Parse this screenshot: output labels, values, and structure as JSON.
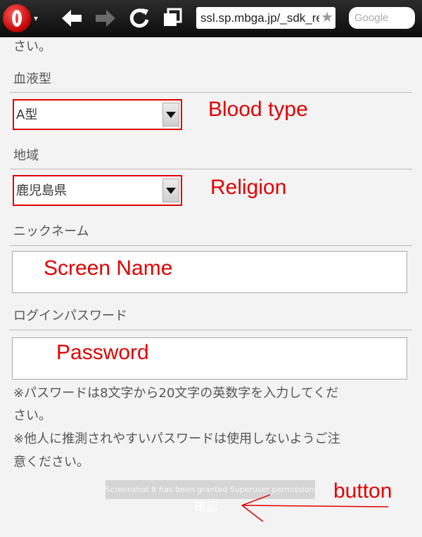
{
  "browser": {
    "url": "ssl.sp.mbga.jp/_sdk_reg",
    "search_placeholder": "Google"
  },
  "page": {
    "top_fragment": "さい。",
    "blood_type": {
      "label": "血液型",
      "selected": "A型"
    },
    "region": {
      "label": "地域",
      "selected": "鹿児島県"
    },
    "nickname": {
      "label": "ニックネーム",
      "value": ""
    },
    "password": {
      "label": "ログインパスワード",
      "value": ""
    },
    "note_lines": [
      "※パスワードは8文字から20文字の英数字を入力してくだ",
      "さい。",
      "※他人に推測されやすいパスワードは使用しないようご注",
      "意ください。"
    ],
    "confirm_label": "確認"
  },
  "toast": "Screenshot It has been granted Superuser permissions",
  "annotations": {
    "blood_type": "Blood type",
    "region": "Religion",
    "screen_name": "Screen Name",
    "password": "Password",
    "button": "button"
  },
  "colors": {
    "annotation": "#e00000",
    "toolbar": "#1a1a1a",
    "page_background": "#f3f3f3"
  }
}
